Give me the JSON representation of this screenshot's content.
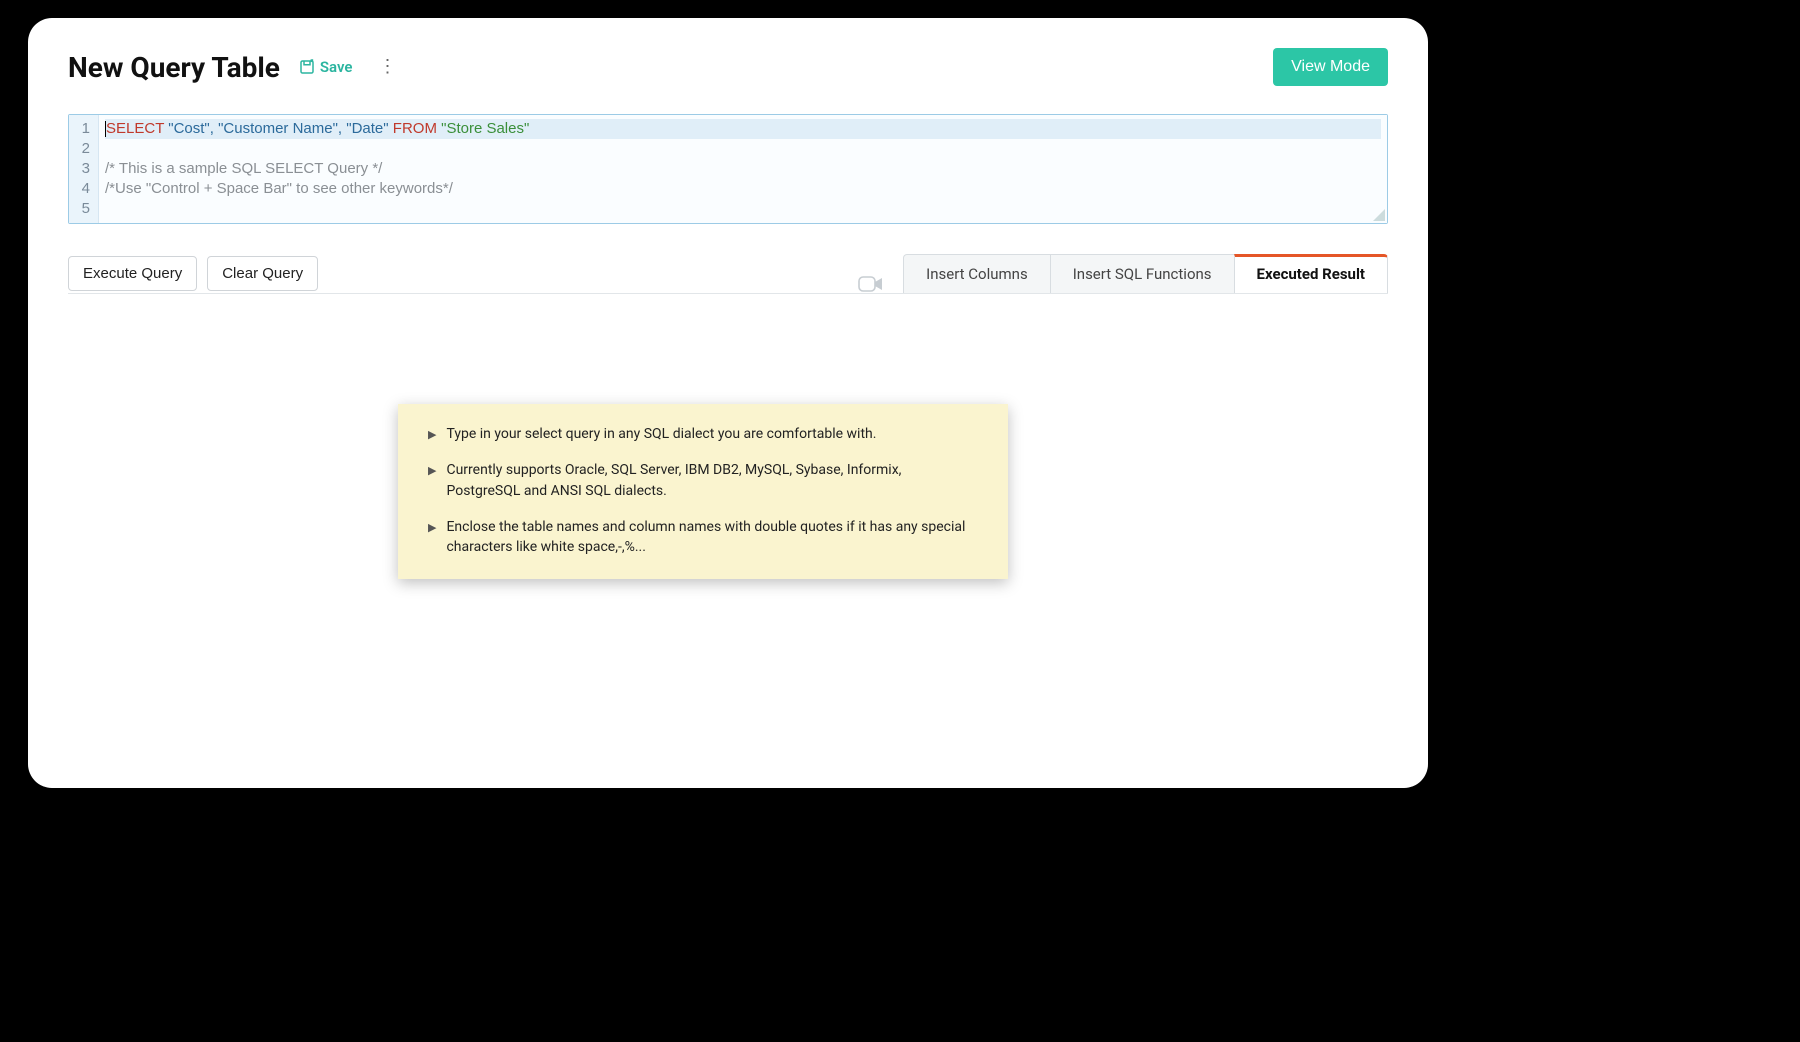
{
  "header": {
    "title": "New Query Table",
    "save_label": "Save",
    "view_mode_label": "View Mode"
  },
  "editor": {
    "lines": [
      "1",
      "2",
      "3",
      "4",
      "5"
    ],
    "line1": {
      "select": "SELECT",
      "cols": " \"Cost\", \"Customer Name\", \"Date\" ",
      "from": "FROM",
      "table": " \"Store Sales\""
    },
    "line3": "/* This is a sample SQL SELECT Query */",
    "line4": "/*Use \"Control + Space Bar\" to see other keywords*/"
  },
  "toolbar": {
    "execute": "Execute Query",
    "clear": "Clear Query"
  },
  "tabs": {
    "insert_columns": "Insert Columns",
    "insert_functions": "Insert SQL Functions",
    "executed_result": "Executed Result"
  },
  "tips": {
    "t1": "Type in your select query in any SQL dialect you are comfortable with.",
    "t2": "Currently supports Oracle, SQL Server, IBM DB2, MySQL, Sybase, Informix, PostgreSQL and ANSI SQL dialects.",
    "t3": "Enclose the table names and column names with double quotes if it has any special characters like white space,-,%..."
  }
}
